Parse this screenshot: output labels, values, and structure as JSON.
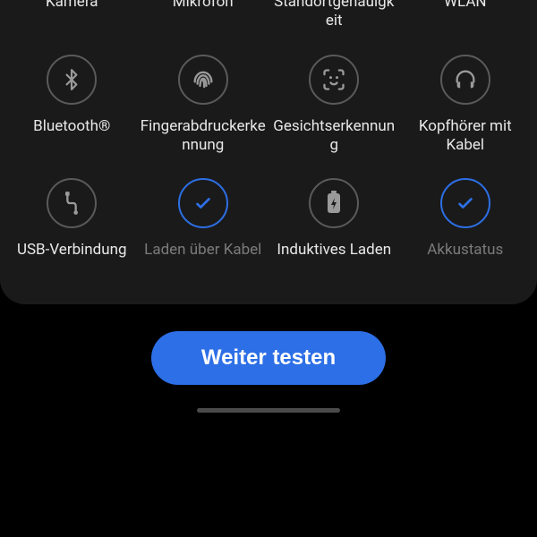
{
  "colors": {
    "accent": "#2d6fe6",
    "panel": "#1a1a1a",
    "icon": "#9a9a9a",
    "text": "#e8e8e8",
    "textDim": "#7b7b7b"
  },
  "diagnostics": {
    "row0": [
      {
        "name": "camera",
        "icon": "camera",
        "label": "Kamera",
        "state": "pending"
      },
      {
        "name": "mic",
        "icon": "mic",
        "label": "Mikrofon",
        "state": "pending"
      },
      {
        "name": "location",
        "icon": "location",
        "label": "Standortgenauigkeit",
        "state": "pending"
      },
      {
        "name": "wifi",
        "icon": "wifi",
        "label": "WLAN",
        "state": "pending"
      }
    ],
    "row1": [
      {
        "name": "bluetooth",
        "icon": "bluetooth",
        "label": "Bluetooth®",
        "state": "pending"
      },
      {
        "name": "fingerprint",
        "icon": "fingerprint",
        "label": "Fingerabdruckerkennung",
        "state": "pending"
      },
      {
        "name": "face",
        "icon": "face",
        "label": "Gesichtserkennung",
        "state": "pending"
      },
      {
        "name": "headphones",
        "icon": "headphones",
        "label": "Kopfhörer mit Kabel",
        "state": "pending"
      }
    ],
    "row2": [
      {
        "name": "usb",
        "icon": "usb",
        "label": "USB-Verbindung",
        "state": "pending"
      },
      {
        "name": "wired-charging",
        "icon": "check",
        "label": "Laden über Kabel",
        "state": "done"
      },
      {
        "name": "wireless-charging",
        "icon": "battery",
        "label": "Induktives Laden",
        "state": "pending"
      },
      {
        "name": "battery-status",
        "icon": "check",
        "label": "Akkustatus",
        "state": "done"
      }
    ]
  },
  "cta_label": "Weiter testen"
}
